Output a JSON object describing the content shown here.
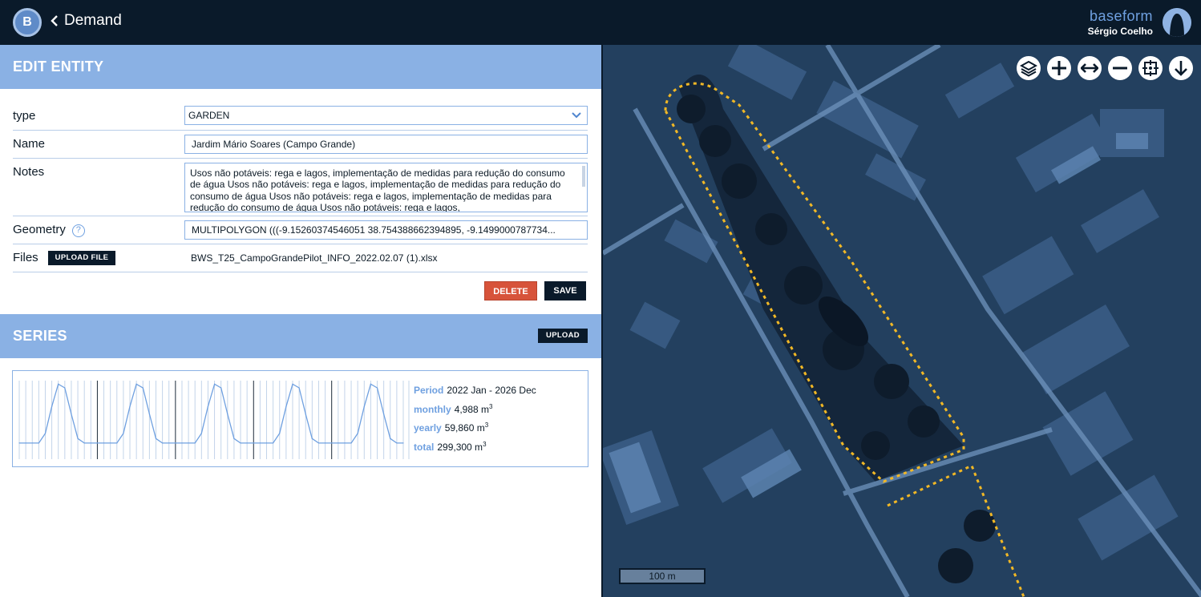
{
  "header": {
    "logo_letter": "B",
    "back_label": "Demand",
    "brand": "baseform",
    "user": "Sérgio Coelho"
  },
  "edit_entity": {
    "title": "EDIT ENTITY",
    "fields": {
      "type_label": "type",
      "type_value": "GARDEN",
      "name_label": "Name",
      "name_value": "Jardim Mário Soares (Campo Grande)",
      "notes_label": "Notes",
      "notes_value": "Usos não potáveis: rega e lagos, implementação de medidas para redução do consumo de água Usos não potáveis: rega e lagos, implementação de medidas para redução do consumo de água Usos não potáveis: rega e lagos, implementação de medidas para redução do consumo de água Usos não potáveis: rega e lagos,",
      "geometry_label": "Geometry",
      "geometry_help": "?",
      "geometry_value": "MULTIPOLYGON (((-9.15260374546051 38.754388662394895, -9.1499000787734...",
      "files_label": "Files",
      "upload_file_label": "UPLOAD FILE",
      "file_name": "BWS_T25_CampoGrandePilot_INFO_2022.02.07 (1).xlsx"
    },
    "delete_label": "DELETE",
    "save_label": "SAVE"
  },
  "series": {
    "title": "SERIES",
    "upload_label": "UPLOAD",
    "period_key": "Period",
    "period_value": "2022 Jan - 2026 Dec",
    "monthly_key": "monthly",
    "monthly_value": "4,988 m",
    "yearly_key": "yearly",
    "yearly_value": "59,860 m",
    "total_key": "total",
    "total_value": "299,300 m",
    "unit_sup": "3"
  },
  "chart_data": {
    "type": "line",
    "x": [
      "2022-01",
      "2022-02",
      "2022-03",
      "2022-04",
      "2022-05",
      "2022-06",
      "2022-07",
      "2022-08",
      "2022-09",
      "2022-10",
      "2022-11",
      "2022-12",
      "2023-01",
      "2023-02",
      "2023-03",
      "2023-04",
      "2023-05",
      "2023-06",
      "2023-07",
      "2023-08",
      "2023-09",
      "2023-10",
      "2023-11",
      "2023-12",
      "2024-01",
      "2024-02",
      "2024-03",
      "2024-04",
      "2024-05",
      "2024-06",
      "2024-07",
      "2024-08",
      "2024-09",
      "2024-10",
      "2024-11",
      "2024-12",
      "2025-01",
      "2025-02",
      "2025-03",
      "2025-04",
      "2025-05",
      "2025-06",
      "2025-07",
      "2025-08",
      "2025-09",
      "2025-10",
      "2025-11",
      "2025-12",
      "2026-01",
      "2026-02",
      "2026-03",
      "2026-04",
      "2026-05",
      "2026-06",
      "2026-07",
      "2026-08",
      "2026-09",
      "2026-10",
      "2026-11",
      "2026-12"
    ],
    "values": [
      1300,
      1300,
      1300,
      1300,
      2600,
      6200,
      9200,
      8700,
      5200,
      1900,
      1300,
      1300,
      1300,
      1300,
      1300,
      1300,
      2600,
      6200,
      9200,
      8700,
      5200,
      1900,
      1300,
      1300,
      1300,
      1300,
      1300,
      1300,
      2600,
      6200,
      9200,
      8700,
      5200,
      1900,
      1300,
      1300,
      1300,
      1300,
      1300,
      1300,
      2600,
      6200,
      9200,
      8700,
      5200,
      1900,
      1300,
      1300,
      1300,
      1300,
      1300,
      1300,
      2600,
      6200,
      9200,
      8700,
      5200,
      1900,
      1300,
      1300
    ],
    "year_boundaries": [
      "2023-01",
      "2024-01",
      "2025-01",
      "2026-01"
    ],
    "color": "#6fa0e0",
    "grid": true
  },
  "map": {
    "scale_label": "100 m",
    "tools": [
      "layers-icon",
      "zoom-in-icon",
      "fit-width-icon",
      "zoom-out-icon",
      "fit-extent-icon",
      "download-icon"
    ]
  }
}
